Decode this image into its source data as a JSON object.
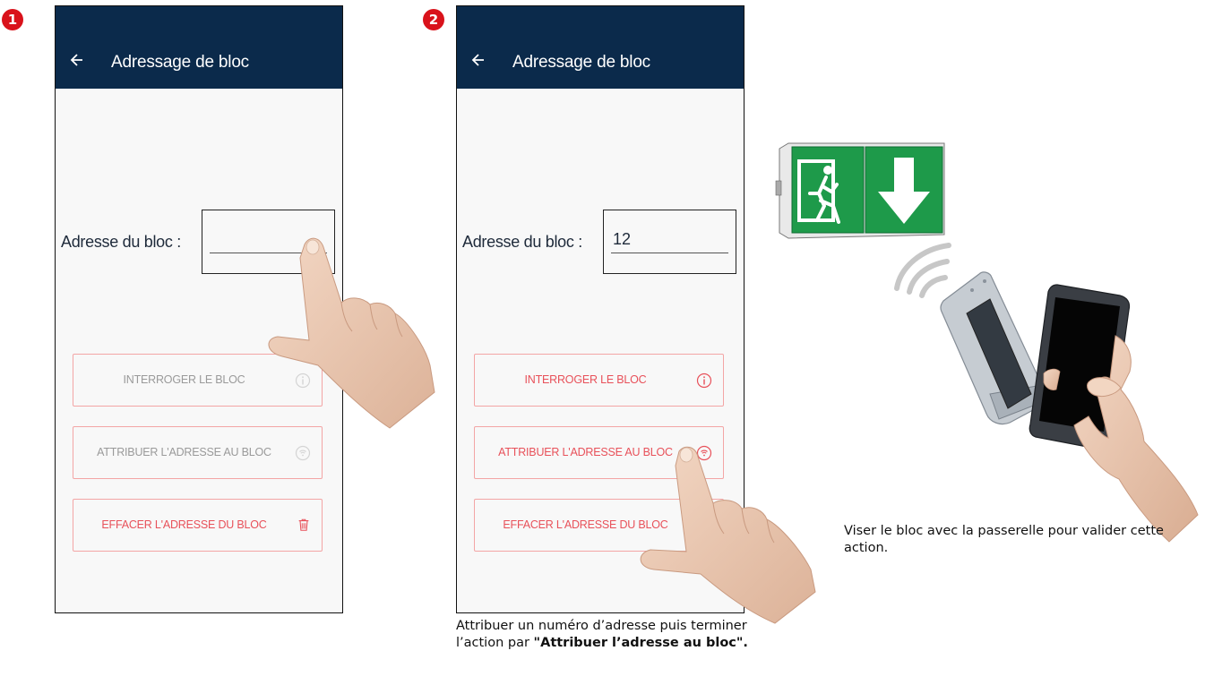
{
  "steps": [
    {
      "badge": "1"
    },
    {
      "badge": "2"
    }
  ],
  "phones": [
    {
      "title": "Adressage de bloc",
      "field_label": "Adresse du bloc :",
      "field_value": "",
      "buttons": {
        "query": "INTERROGER LE BLOC",
        "assign": "ATTRIBUER L'ADRESSE AU BLOC",
        "erase": "EFFACER L'ADRESSE DU BLOC"
      }
    },
    {
      "title": "Adressage de bloc",
      "field_label": "Adresse du bloc :",
      "field_value": "12",
      "buttons": {
        "query": "INTERROGER LE BLOC",
        "assign": "ATTRIBUER L'ADRESSE AU BLOC",
        "erase": "EFFACER L'ADRESSE DU BLOC"
      }
    }
  ],
  "captions": {
    "step2_text": "Attribuer un numéro d’adresse puis terminer l’action par ",
    "step2_bold": "\"Attribuer l’adresse au bloc\".",
    "right_text": "Viser le bloc avec la passerelle pour valider cette action."
  },
  "colors": {
    "header": "#0b2a4b",
    "accent_red": "#e8515a",
    "badge_red": "#d9121b",
    "exit_green": "#1e9a4a"
  },
  "icons": [
    "back-arrow-icon",
    "info-icon",
    "wireless-icon",
    "trash-icon",
    "pointing-hand-icon",
    "exit-sign-icon",
    "gateway-device-icon",
    "smartphone-icon",
    "signal-waves-icon"
  ]
}
